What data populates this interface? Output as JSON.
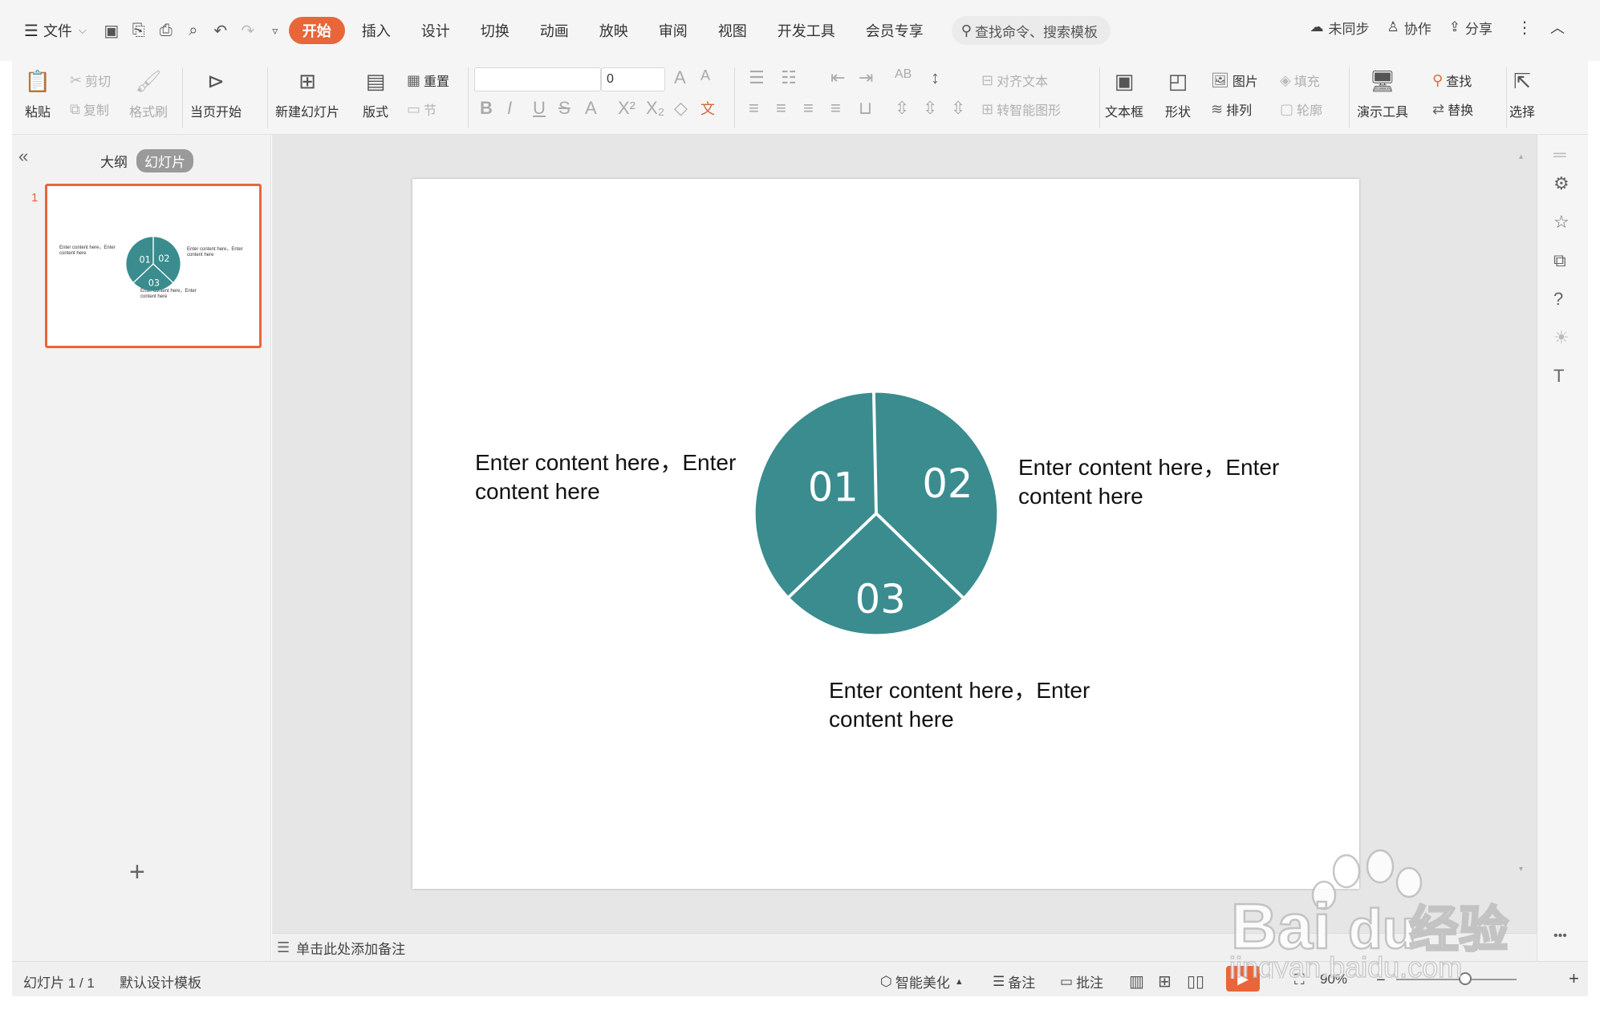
{
  "menubar": {
    "file_label": "文件",
    "tabs": [
      {
        "label": "开始",
        "active": true
      },
      {
        "label": "插入"
      },
      {
        "label": "设计"
      },
      {
        "label": "切换"
      },
      {
        "label": "动画"
      },
      {
        "label": "放映"
      },
      {
        "label": "审阅"
      },
      {
        "label": "视图"
      },
      {
        "label": "开发工具"
      },
      {
        "label": "会员专享"
      }
    ],
    "search_placeholder": "查找命令、搜索模板",
    "sync_label": "未同步",
    "collab_label": "协作",
    "share_label": "分享"
  },
  "ribbon": {
    "paste": "粘贴",
    "cut": "剪切",
    "copy": "复制",
    "format_painter": "格式刷",
    "play_from_current": "当页开始",
    "new_slide": "新建幻灯片",
    "layout": "版式",
    "reset": "重置",
    "section": "节",
    "font_name": "",
    "font_size": "0",
    "align_text": "对齐文本",
    "convert_smartart": "转智能图形",
    "textbox": "文本框",
    "shape": "形状",
    "picture": "图片",
    "fill": "填充",
    "arrange": "排列",
    "outline": "轮廓",
    "present_tools": "演示工具",
    "find": "查找",
    "replace": "替换",
    "select": "选择"
  },
  "left_pane": {
    "tab_outline": "大纲",
    "tab_slides": "幻灯片",
    "slide_number": "1"
  },
  "slide": {
    "pie_labels": [
      "01",
      "02",
      "03"
    ],
    "accent_color": "#3a8c8f",
    "text_left_1": "Enter content here，Enter",
    "text_left_2": "content here",
    "text_right_1": "Enter content here，Enter",
    "text_right_2": "content here",
    "text_bottom_1": "Enter content here，Enter",
    "text_bottom_2": "content here",
    "thumb_text_left": "Enter content here，Enter content here",
    "thumb_text_right": "Enter content here，Enter content here",
    "thumb_text_bottom": "Enter content here，Enter content here"
  },
  "notes": {
    "placeholder": "单击此处添加备注"
  },
  "statusbar": {
    "slide_indicator": "幻灯片 1 / 1",
    "template": "默认设计模板",
    "smart_beautify": "智能美化",
    "notes": "备注",
    "comments": "批注",
    "zoom": "90%"
  },
  "watermark": {
    "brand": "Bai",
    "brand2": "du",
    "brand_cn": "经验",
    "url": "jingyan.baidu.com"
  }
}
